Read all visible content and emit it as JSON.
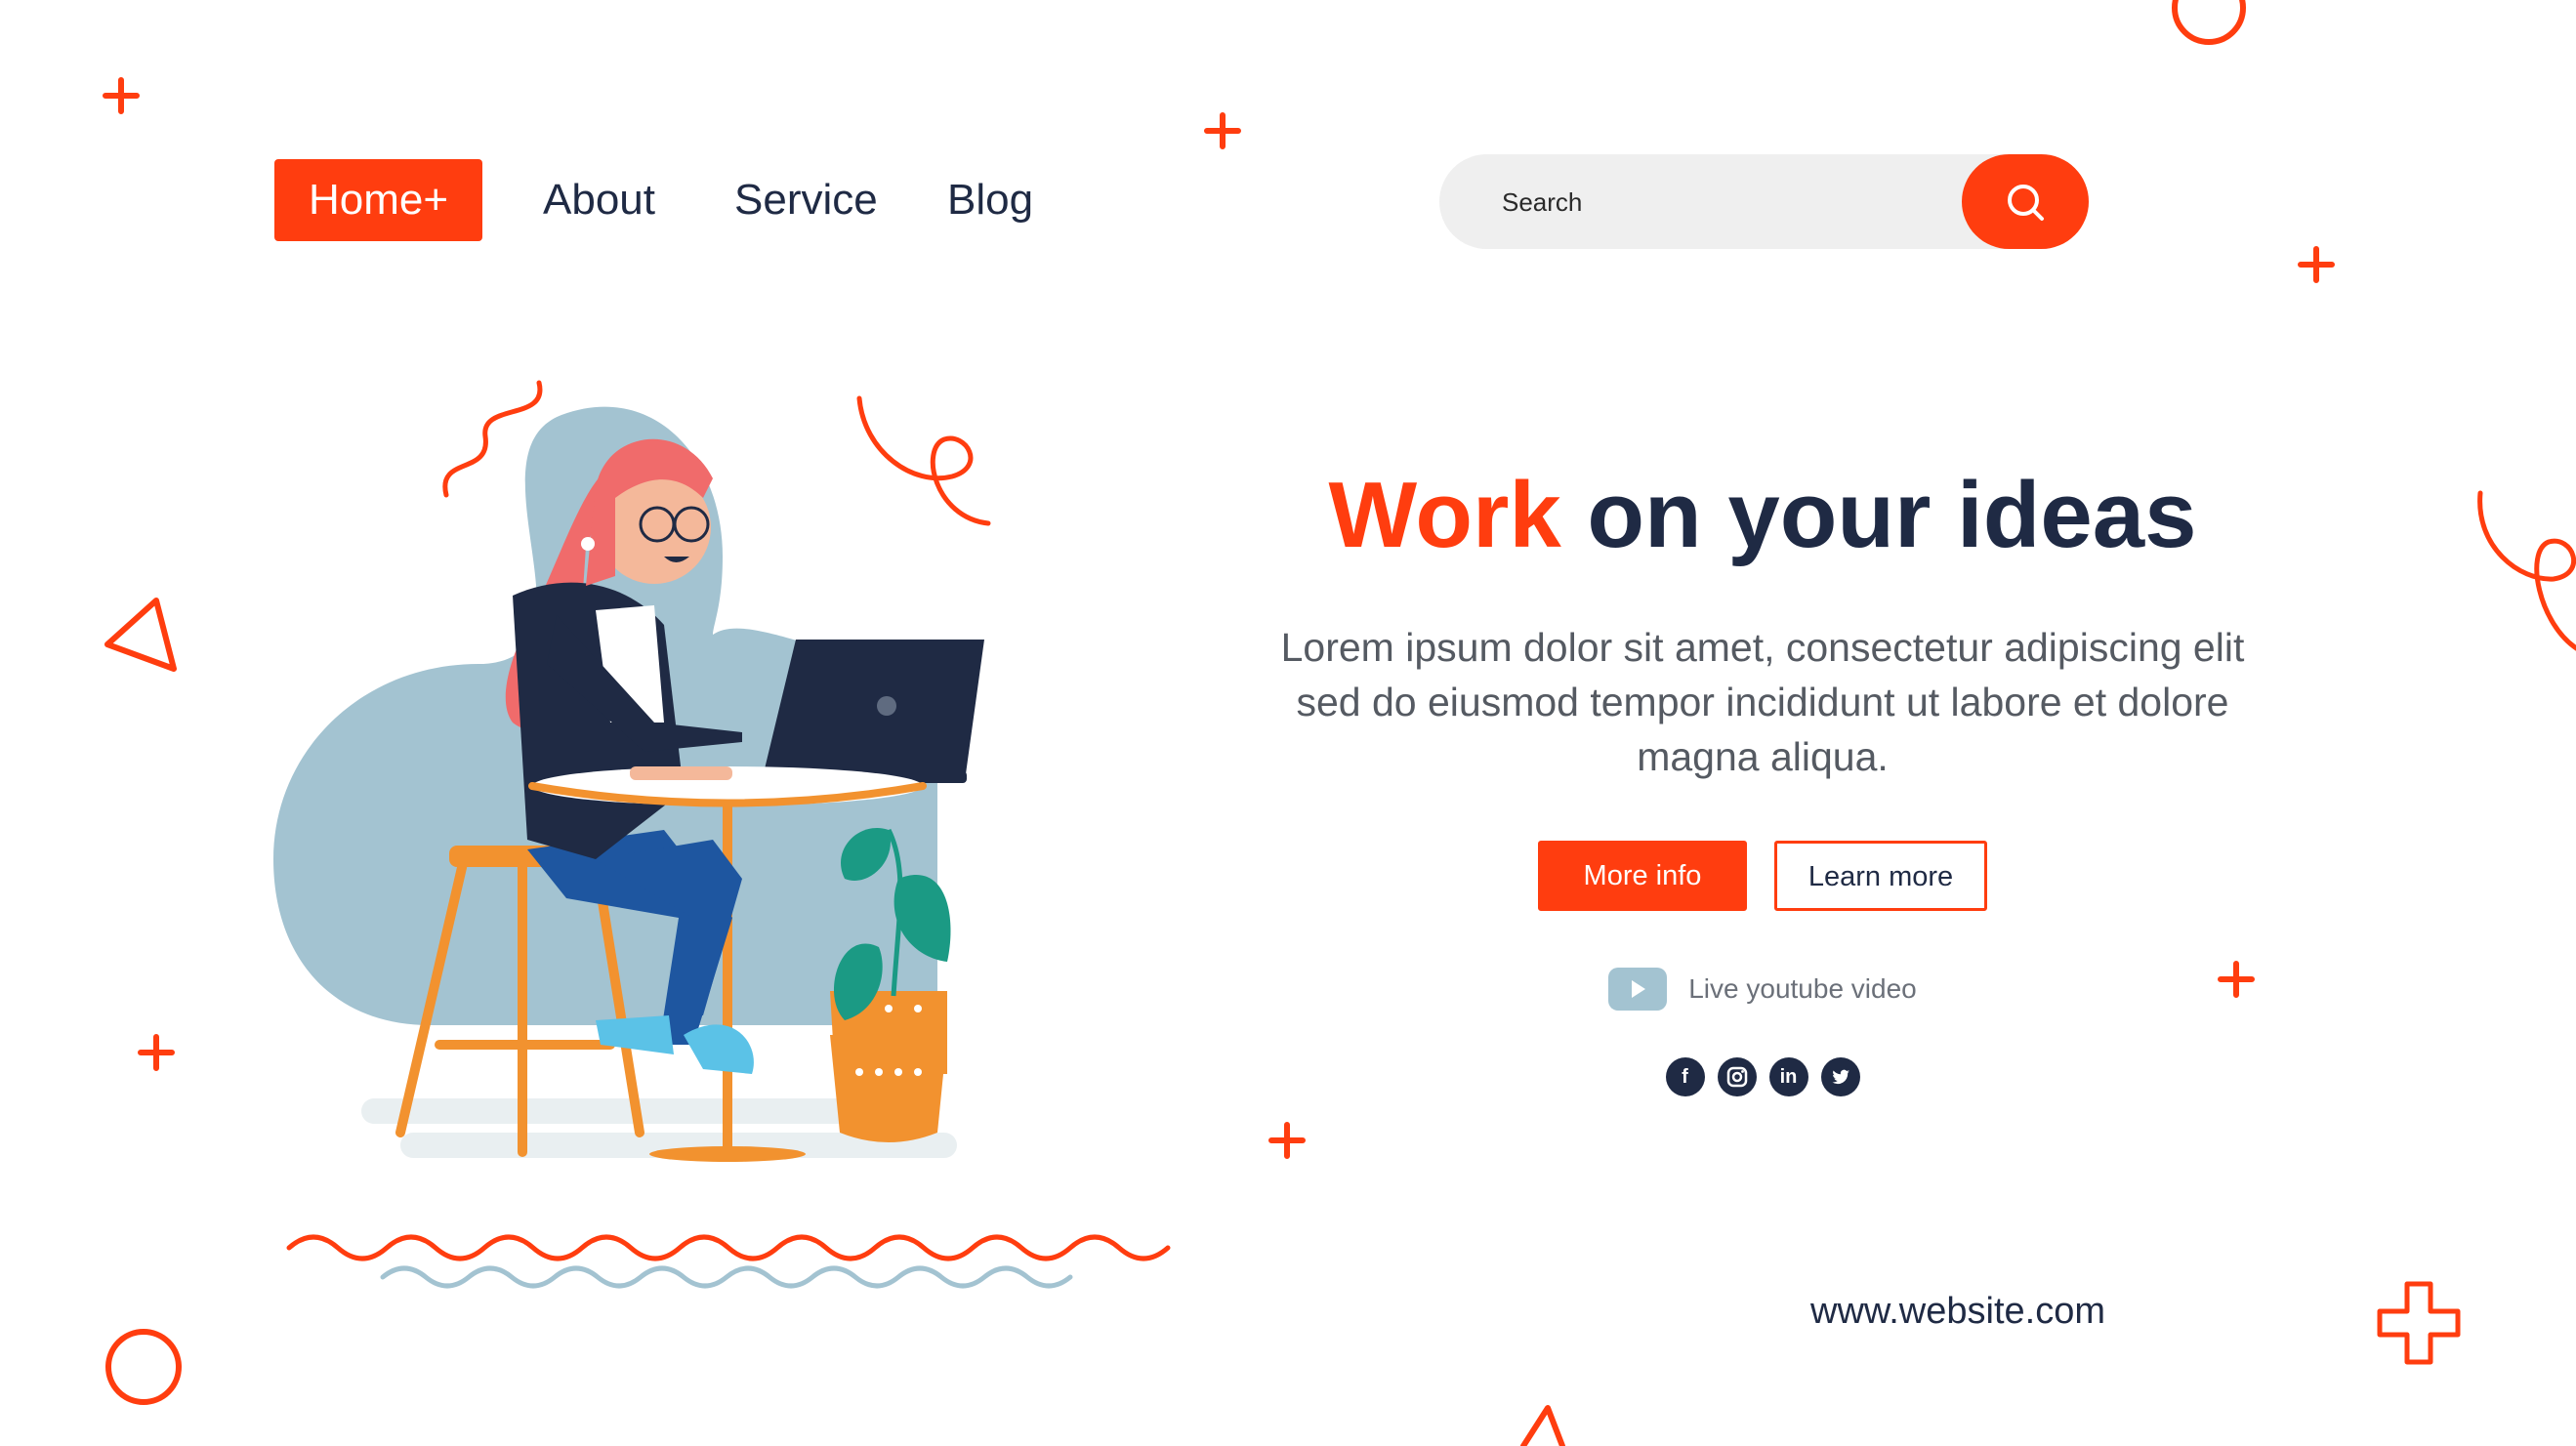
{
  "nav": {
    "items": [
      {
        "label": "Home+",
        "active": true
      },
      {
        "label": "About"
      },
      {
        "label": "Service"
      },
      {
        "label": "Blog"
      }
    ]
  },
  "search": {
    "placeholder": "Search",
    "icon": "search-icon"
  },
  "hero": {
    "title_accent": "Work",
    "title_rest": " on your ideas",
    "description": "Lorem ipsum dolor sit amet, consectetur adipiscing elit sed do eiusmod tempor incididunt ut labore et dolore magna aliqua.",
    "more_info_label": "More info",
    "learn_more_label": "Learn more"
  },
  "video": {
    "label": "Live youtube video",
    "icon": "youtube-icon"
  },
  "social": {
    "facebook": "f",
    "linkedin": "in",
    "icons": [
      "facebook-icon",
      "instagram-icon",
      "linkedin-icon",
      "twitter-icon"
    ]
  },
  "footer": {
    "url": "www.website.com"
  },
  "colors": {
    "accent": "#ff3d0f",
    "dark": "#1f2a44",
    "blob": "#a3c3d1",
    "orange": "#f2922f",
    "plant": "#1b9a84"
  }
}
